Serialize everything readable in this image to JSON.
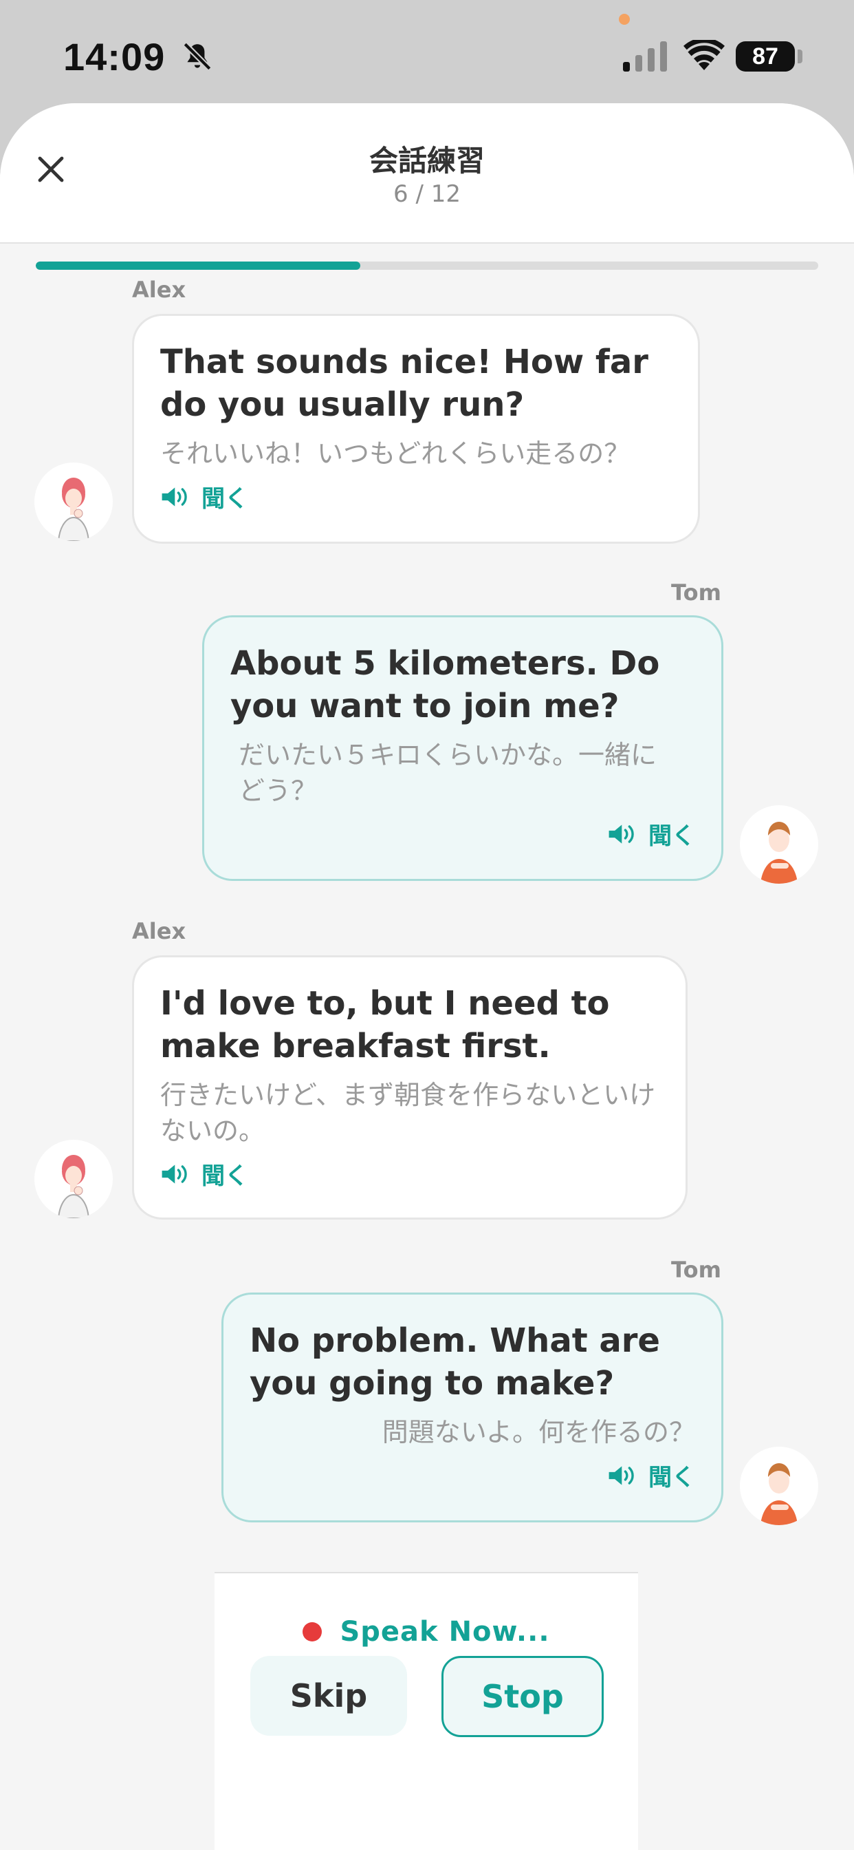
{
  "status": {
    "time": "14:09",
    "battery": "87"
  },
  "header": {
    "title": "会話練習",
    "progress_text": "6 / 12",
    "progress_fraction": 0.5
  },
  "messages": [
    {
      "speaker": "Alex",
      "english": "That sounds nice! How far do you usually run?",
      "japanese": "それいいね！いつもどれくらい走るの？",
      "listen": "聞く"
    },
    {
      "speaker": "Tom",
      "english": "About 5 kilometers. Do you want to join me?",
      "japanese": "だいたい５キロくらいかな。一緒にどう？",
      "listen": "聞く"
    },
    {
      "speaker": "Alex",
      "english": "I'd love to, but I need to make breakfast first.",
      "japanese": "行きたいけど、まず朝食を作らないといけないの。",
      "listen": "聞く"
    },
    {
      "speaker": "Tom",
      "english": "No problem. What are you going to make?",
      "japanese": "問題ないよ。何を作るの？",
      "listen": "聞く"
    }
  ],
  "controls": {
    "speak_label": "Speak Now...",
    "skip_label": "Skip",
    "stop_label": "Stop"
  },
  "colors": {
    "accent": "#13a296",
    "record": "#e63b3b",
    "bubble_right_bg": "#eef8f8",
    "bubble_right_border": "#a9dcd9"
  },
  "icons": {
    "close": "close-icon",
    "speaker": "speaker-icon",
    "bell_muted": "bell-slash-icon"
  }
}
